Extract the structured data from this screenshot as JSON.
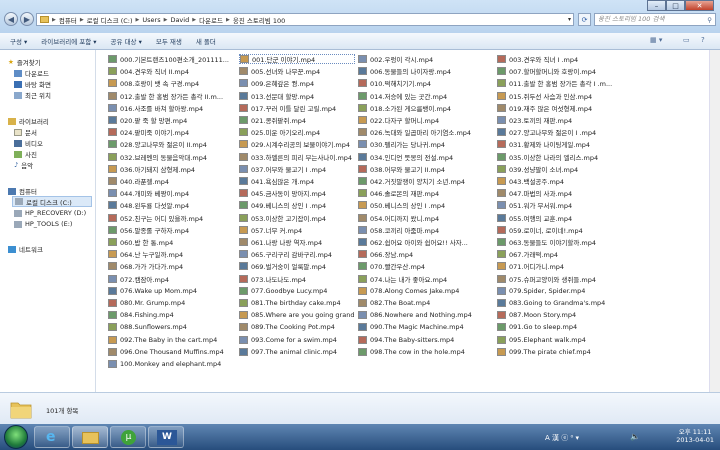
{
  "window": {
    "breadcrumb": [
      "컴퓨터",
      "로컬 디스크 (C:)",
      "Users",
      "David",
      "다운로드",
      "웅진 스토리빔 100"
    ],
    "search_placeholder": "웅진 스토리빔 100 검색"
  },
  "toolbar": {
    "organize": "구성 ▾",
    "include_library": "라이브러리에 포함 ▾",
    "share": "공유 대상 ▾",
    "play_all": "모두 재생",
    "new_folder": "새 폴더"
  },
  "nav": {
    "favorites": "즐겨찾기",
    "downloads": "다운로드",
    "desktop": "바탕 화면",
    "recent": "최근 위치",
    "libraries": "라이브러리",
    "documents": "문서",
    "videos": "비디오",
    "pictures": "사진",
    "music": "음악",
    "computer": "컴퓨터",
    "local_disk": "로컬 디스크 (C:)",
    "hp_recovery": "HP_RECOVERY (D:)",
    "hp_tools": "HP_TOOLS (E:)",
    "network": "네트워크"
  },
  "files": [
    [
      "000.기본트랜즈100편소개_201111...",
      "001.단군 이야기.mp4",
      "002.우렁이 각시.mp4",
      "003.견우와 직녀 I .mp4"
    ],
    [
      "004.견우와 직녀 II.mp4",
      "005.선녀와 나무꾼.mp4",
      "006.동물들의 나이자랑.mp4",
      "007.할머할머니와 호랑이.mp4"
    ],
    [
      "008.호랑이 뱃 속 구경.mp4",
      "009.은혜갚은 꿩.mp4",
      "010.떡해치기기.mp4",
      "011.출발 한 홍범 장가든 총각 I .m..."
    ],
    [
      "012.출발 한 홍범 장가든 총각 II.m...",
      "013.선문대 할망.mp4",
      "014.저승에 있는 곳간.mp4",
      "015.쥐두선 사슴과 인삼.mp4"
    ],
    [
      "016.사조를 바쳐 할아왕.mp4",
      "017.꾸러 이틀 달린 고릴.mp4",
      "018.소가된 게으름뱅이.mp4",
      "019.재주 많은 여섯형제.mp4"
    ],
    [
      "020.팥 죽 할 망편.mp4",
      "021.콩쥐팥쥐.mp4",
      "022.다자구 할머니.mp4",
      "023.토끼의 재판.mp4"
    ],
    [
      "024.팥미죽 이야기.mp4",
      "025.미운 아기오리.mp4",
      "026.녹대와 일곱마리 아기염소.mp4",
      "027.양고나무와 젊은이 I .mp4"
    ],
    [
      "028.양고나무와 젊은이 II.mp4",
      "029.시계수리공의 보물이야기.mp4",
      "030.펠리가는 당나귀.mp4",
      "031.황제와 나이팅게일.mp4"
    ],
    [
      "032.브레멘의 동물음악대.mp4",
      "033.하멜른의 피리 부는사나이.mp4",
      "034.인디언 뜻몽의 전설.mp4",
      "035.이상한 나라의 엘리스.mp4"
    ],
    [
      "036.아기돼지 삼형제.mp4",
      "037.어부와 물고기 I .mp4",
      "038.어부와 물고기 II.mp4",
      "039.성냥팔이 소녀.mp4"
    ],
    [
      "040.라푼젤.mp4",
      "041.욕심많은 개.mp4",
      "042.거짓말쟁이 양치기 소년.mp4",
      "043.백설공주.mp4"
    ],
    [
      "044.개미와 베짱이.mp4",
      "045.금사동이 망아지.mp4",
      "046.솔로몬의 재판.mp4",
      "047.마법의 사과.mp4"
    ],
    [
      "048.왼두룡 다섯알.mp4",
      "049.베니스의 상인 I .mp4",
      "050.베니스의 상인 I .mp4",
      "051.워가 무서워.mp4"
    ],
    [
      "052.친구는 어디 있을까.mp4",
      "053.이상한 고기잡이.mp4",
      "054.어디까지 왔니.mp4",
      "055.여행의 교훈.mp4"
    ],
    [
      "056.말종롤 구하자.mp4",
      "057.너무 커.mp4",
      "058.코끼리 아줌마.mp4",
      "059.로이너, 로이네!.mp4"
    ],
    [
      "060.밥 한 통.mp4",
      "061.나랑 나랑 역자.mp4",
      "062.쉽어요 아이와 쉽어요!! 사자...",
      "063.동물들도 이야기할까.mp4"
    ],
    [
      "064.난 누구일까.mp4",
      "065.구리구리 감바구리.mp4",
      "066.장남.mp4",
      "067.가래떡.mp4"
    ],
    [
      "068.가가 가다가.mp4",
      "069.벌거숭이 얼룩말.mp4",
      "070.빨간우산.mp4",
      "071.어디가니.mp4"
    ],
    [
      "072.캠잠아.mp4",
      "073.나도나도.mp4",
      "074.나는 내가 좋아요.mp4",
      "075.슈퍼고양이와 생쥐들.mp4"
    ],
    [
      "076.Wake up Mom.mp4",
      "077.Goodbye Lucy.mp4",
      "078.Along Comes Jake.mp4",
      "079.Spider, Spider.mp4"
    ],
    [
      "080.Mr. Grump.mp4",
      "081.The birthday cake.mp4",
      "082.The Boat.mp4",
      "083.Going to Grandma's.mp4"
    ],
    [
      "084.Fishing.mp4",
      "085.Where are you going grandpa_...",
      "086.Nowhere and Nothing.mp4",
      "087.Moon Story.mp4"
    ],
    [
      "088.Sunflowers.mp4",
      "089.The Cooking Pot.mp4",
      "090.The Magic Machine.mp4",
      "091.Go to sleep.mp4"
    ],
    [
      "092.The Baby in the cart.mp4",
      "093.Come for a swim.mp4",
      "094.The Baby-sitters.mp4",
      "095.Elephant walk.mp4"
    ],
    [
      "096.One Thousand Muffins.mp4",
      "097.The animal clinic.mp4",
      "098.The cow in the hole.mp4",
      "099.The pirate chief.mp4"
    ],
    [
      "100.Monkey and elephant.mp4",
      "",
      "",
      ""
    ]
  ],
  "details": {
    "item_count": "101개 항목"
  },
  "clock": {
    "time": "오후 11:11",
    "date": "2013-04-01"
  },
  "tray": {
    "ime": "A 漢 ⓔ ⁰ ▾"
  },
  "colors": {
    "accent": "#274d7c",
    "selection": "#dbe9f8",
    "folder": "#e7c25a"
  }
}
